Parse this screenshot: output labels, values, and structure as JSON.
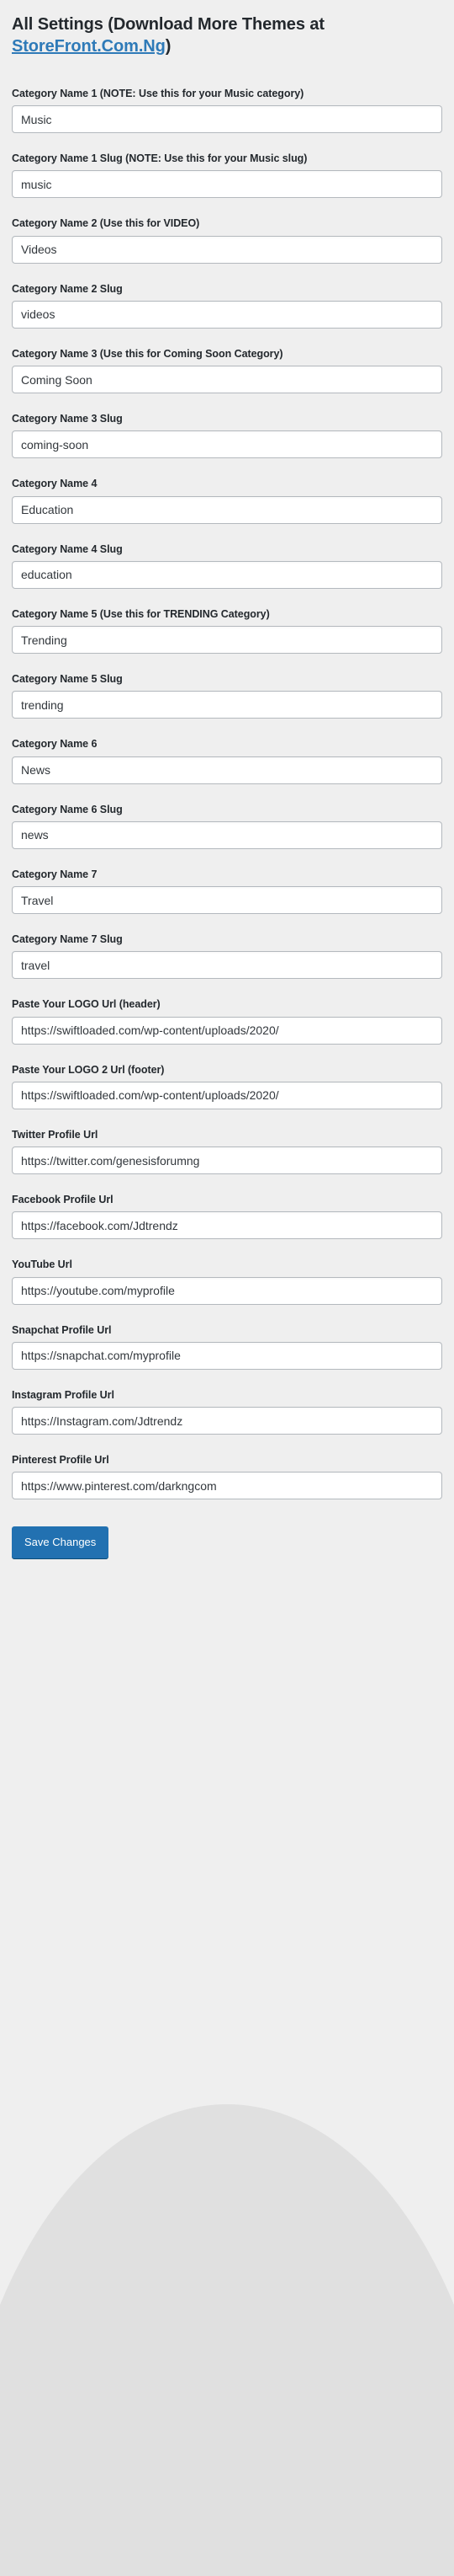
{
  "page": {
    "title_prefix": "All Settings (Download More Themes at ",
    "title_link": "StoreFront.Com.Ng",
    "title_suffix": ")"
  },
  "fields": [
    {
      "label": "Category Name 1 (NOTE: Use this for your Music category)",
      "value": "Music",
      "name": "category-name-1"
    },
    {
      "label": "Category Name 1 Slug (NOTE: Use this for your Music slug)",
      "value": "music",
      "name": "category-name-1-slug"
    },
    {
      "label": "Category Name 2 (Use this for VIDEO)",
      "value": "Videos",
      "name": "category-name-2"
    },
    {
      "label": "Category Name 2 Slug",
      "value": "videos",
      "name": "category-name-2-slug"
    },
    {
      "label": "Category Name 3 (Use this for Coming Soon Category)",
      "value": "Coming Soon",
      "name": "category-name-3"
    },
    {
      "label": "Category Name 3 Slug",
      "value": "coming-soon",
      "name": "category-name-3-slug"
    },
    {
      "label": "Category Name 4",
      "value": "Education",
      "name": "category-name-4"
    },
    {
      "label": "Category Name 4 Slug",
      "value": "education",
      "name": "category-name-4-slug"
    },
    {
      "label": "Category Name 5 (Use this for TRENDING Category)",
      "value": "Trending",
      "name": "category-name-5"
    },
    {
      "label": "Category Name 5 Slug",
      "value": "trending",
      "name": "category-name-5-slug"
    },
    {
      "label": "Category Name 6",
      "value": "News",
      "name": "category-name-6"
    },
    {
      "label": "Category Name 6 Slug",
      "value": "news",
      "name": "category-name-6-slug"
    },
    {
      "label": "Category Name 7",
      "value": "Travel",
      "name": "category-name-7"
    },
    {
      "label": "Category Name 7 Slug",
      "value": "travel",
      "name": "category-name-7-slug"
    },
    {
      "label": "Paste Your LOGO Url (header)",
      "value": "https://swiftloaded.com/wp-content/uploads/2020/",
      "name": "logo-url-header"
    },
    {
      "label": "Paste Your LOGO 2 Url (footer)",
      "value": "https://swiftloaded.com/wp-content/uploads/2020/",
      "name": "logo-2-url-footer"
    },
    {
      "label": "Twitter Profile Url",
      "value": "https://twitter.com/genesisforumng",
      "name": "twitter-profile-url"
    },
    {
      "label": "Facebook Profile Url",
      "value": "https://facebook.com/Jdtrendz",
      "name": "facebook-profile-url"
    },
    {
      "label": "YouTube Url",
      "value": "https://youtube.com/myprofile",
      "name": "youtube-url"
    },
    {
      "label": "Snapchat Profile Url",
      "value": "https://snapchat.com/myprofile",
      "name": "snapchat-profile-url"
    },
    {
      "label": "Instagram Profile Url",
      "value": "https://Instagram.com/Jdtrendz",
      "name": "instagram-profile-url"
    },
    {
      "label": "Pinterest Profile Url",
      "value": "https://www.pinterest.com/darkngcom",
      "name": "pinterest-profile-url"
    }
  ],
  "actions": {
    "save_label": "Save Changes"
  },
  "colors": {
    "page_background": "#efefef",
    "curve": "#e0e0e0",
    "accent_blue": "#2271b1",
    "link_blue": "#2e7ab8",
    "input_border": "#b4b9be",
    "text": "#23282d"
  }
}
